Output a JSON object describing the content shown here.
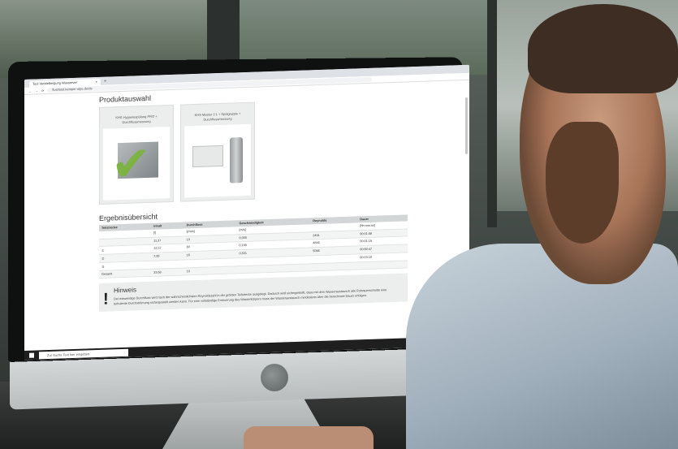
{
  "browser": {
    "tab_title": "Tool Verbleibeigung Wasserver",
    "tab_close": "×",
    "new_tab": "+",
    "url": "flushtool.kemper-olpe.de/de"
  },
  "page": {
    "produktauswahl_heading": "Produktauswahl",
    "products": [
      {
        "title": "KHS Hygienespülung PRO + Durchflussmessung",
        "selected": true
      },
      {
        "title": "KHS Master 2.1 + Spülgruppe + Durchflussmessung",
        "selected": false
      }
    ],
    "ergebnis_heading": "Ergebnisübersicht",
    "table": {
      "headers": [
        "Teilstrecke",
        "Inhalt",
        "Durchfluss",
        "Geschwindigkeit",
        "Reynolds",
        "Dauer"
      ],
      "units": [
        "",
        "[l]",
        "[l/min]",
        "[m/s]",
        "",
        "[hh:mm:ss]"
      ],
      "rows": [
        [
          "",
          "11,37",
          "10",
          "0,000",
          "2491",
          "00:01:08"
        ],
        [
          "①",
          "12,57",
          "60",
          "0,155",
          "4846",
          "00:01:15"
        ],
        [
          "②",
          "7,85",
          "16",
          "0,531",
          "5096",
          "00:00:47"
        ],
        [
          "③",
          "",
          "",
          "",
          "",
          "00:03:10"
        ],
        [
          "Gesamt",
          "33,68",
          "10",
          "",
          "",
          ""
        ]
      ]
    },
    "hinweis_heading": "Hinweis",
    "hinweis_text": "Der notwendige Durchfluss wird nach der wahrscheinlichsten Reynoldszahl in der größten Teilstrecke ausgelegt. Dadurch wird sichergestellt, dass mit dem Wasseraustausch alle Rohrquerschnitte eine turbulente Durchströmung sichergestellt werden kann. Für eine vollständige Erneuerung des Wasserkörpers muss der Wasseraustausch mindestens über die berechnete Dauer erfolgen."
  },
  "taskbar": {
    "search_placeholder": "Zur Suche Text hier eingeben"
  }
}
